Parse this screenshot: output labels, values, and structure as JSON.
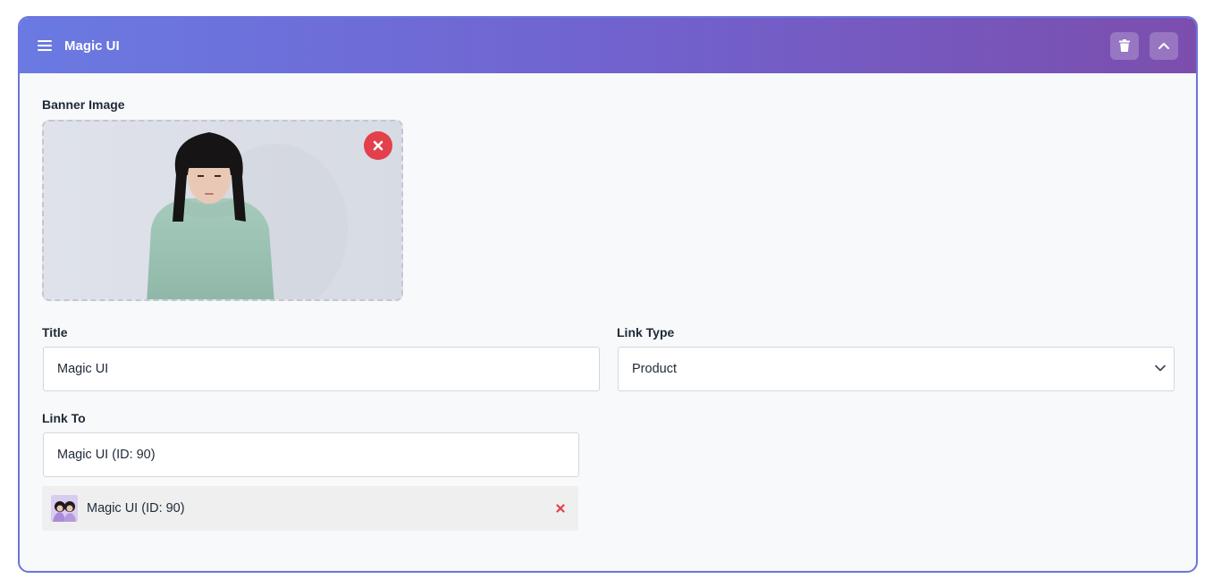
{
  "header": {
    "title": "Magic UI",
    "actions": [
      "trash-icon",
      "chevron-up-icon"
    ]
  },
  "banner": {
    "label": "Banner Image"
  },
  "title_field": {
    "label": "Title",
    "value": "Magic UI"
  },
  "link_type": {
    "label": "Link Type",
    "value": "Product"
  },
  "link_to": {
    "label": "Link To",
    "value": "Magic UI (ID: 90)",
    "selected": {
      "label": "Magic UI (ID: 90)"
    }
  },
  "colors": {
    "header_start": "#6a7ae2",
    "header_end": "#7b4eae",
    "border": "#6b74dc",
    "danger": "#e2404b"
  }
}
